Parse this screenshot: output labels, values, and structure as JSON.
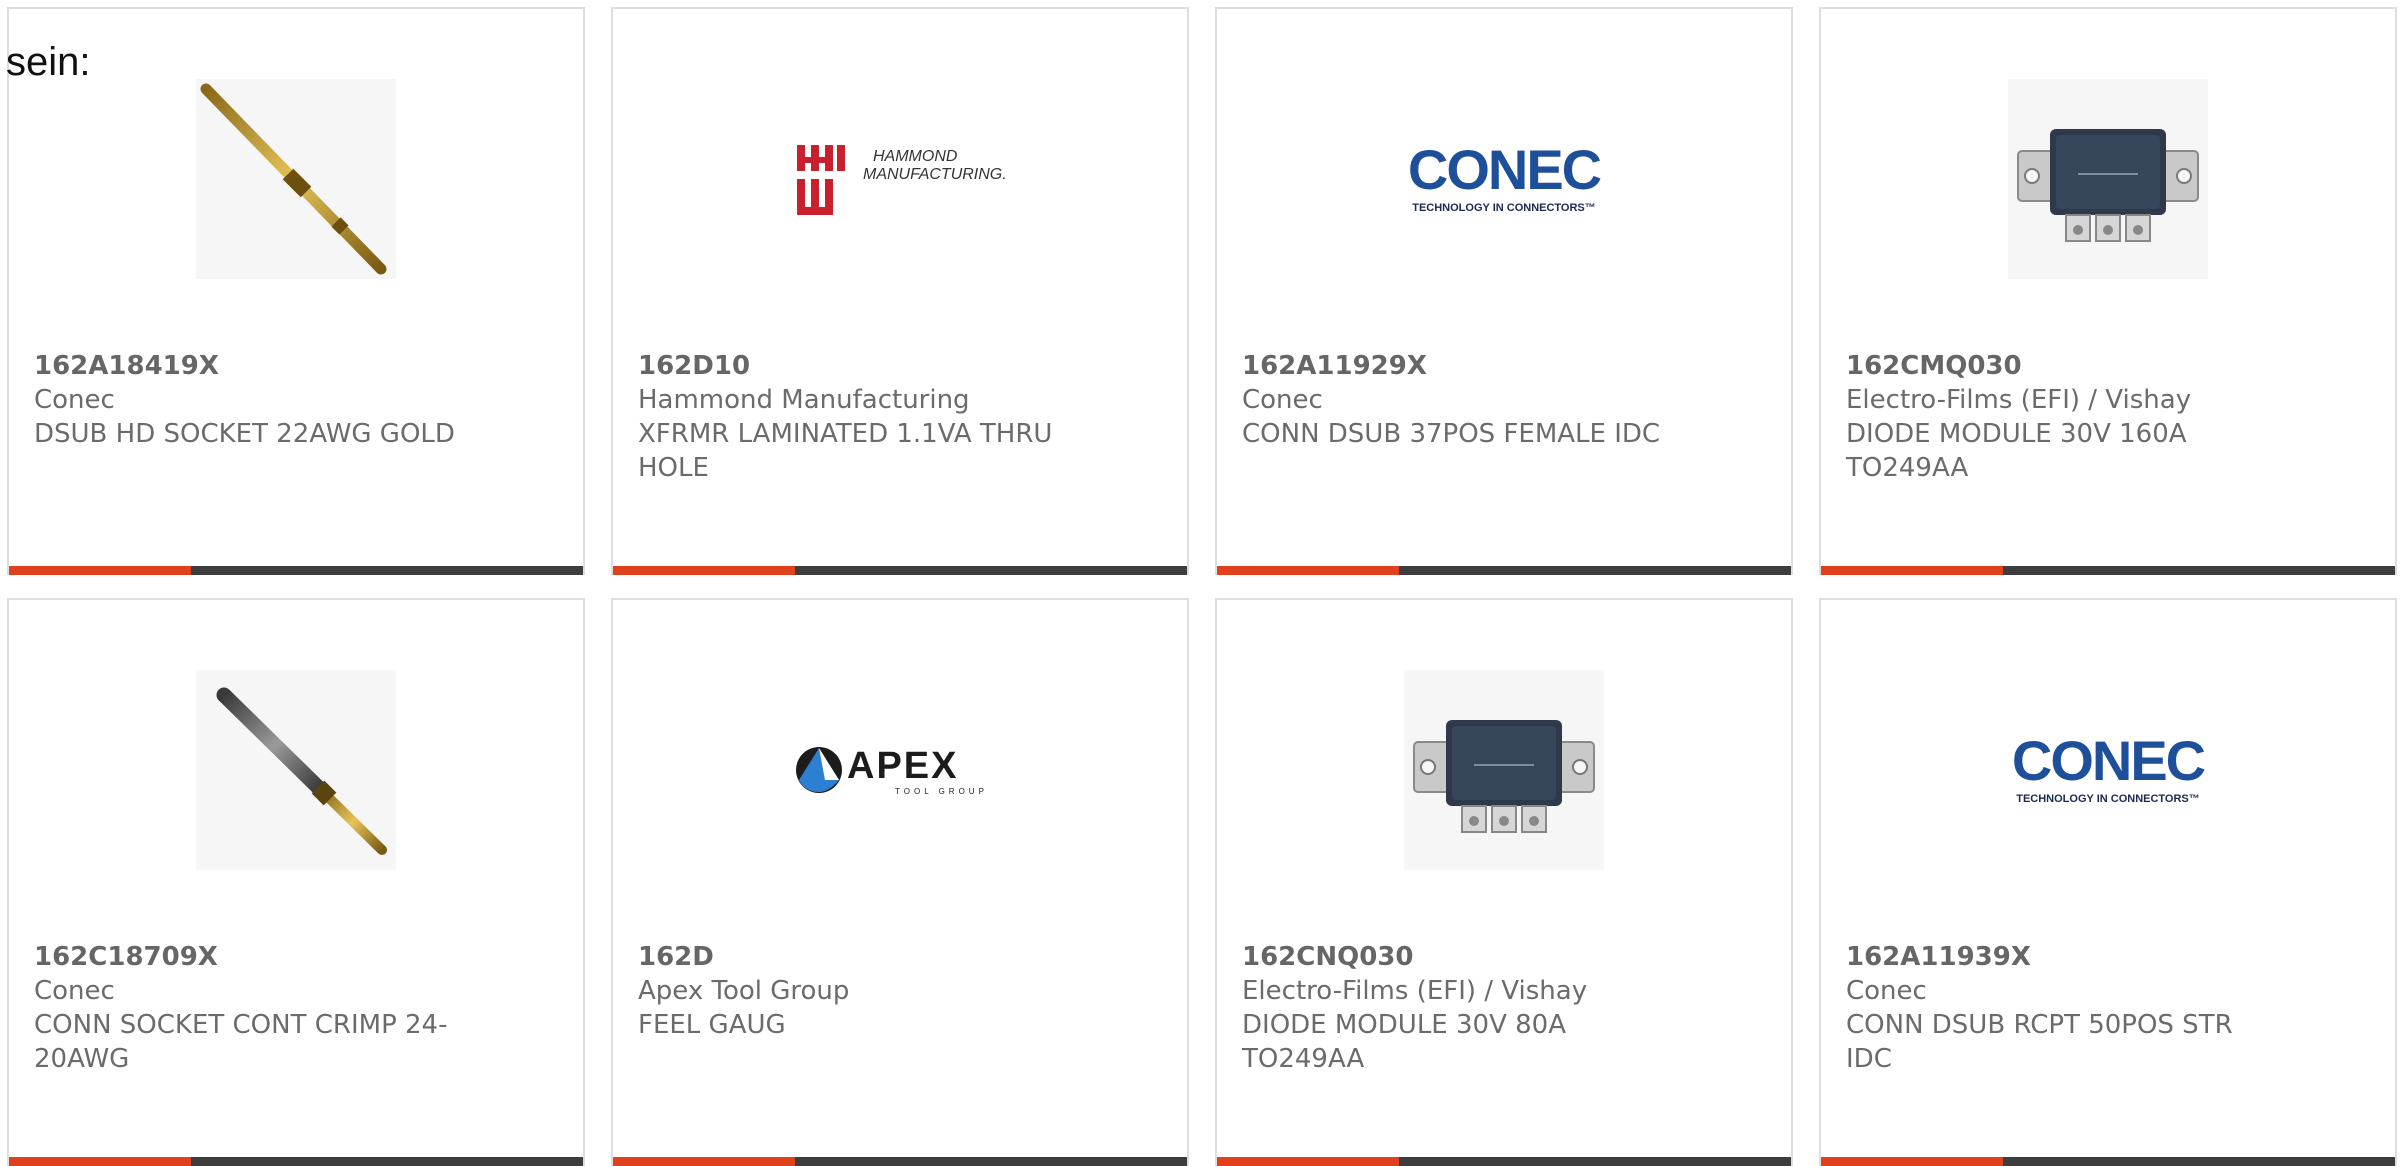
{
  "intro_text": "sein:",
  "colors": {
    "accent": "#e0411d",
    "bar": "#3d3d3d",
    "conec_blue": "#1d4f9a",
    "hammond_red": "#c8202c"
  },
  "products": [
    {
      "part_number": "162A18419X",
      "manufacturer": "Conec",
      "description": "DSUB HD SOCKET 22AWG GOLD",
      "image": "gold-pin-contact-icon"
    },
    {
      "part_number": "162D10",
      "manufacturer": "Hammond Manufacturing",
      "description": "XFRMR LAMINATED 1.1VA THRU HOLE",
      "image": "hammond-logo",
      "logo_line1": "HAMMOND",
      "logo_line2": "MANUFACTURING."
    },
    {
      "part_number": "162A11929X",
      "manufacturer": "Conec",
      "description": "CONN DSUB 37POS FEMALE IDC",
      "image": "conec-logo",
      "logo_main": "CONEC",
      "logo_tag": "TECHNOLOGY IN CONNECTORS™"
    },
    {
      "part_number": "162CMQ030",
      "manufacturer": "Electro-Films (EFI) / Vishay",
      "description": "DIODE MODULE 30V 160A TO249AA",
      "image": "diode-module-icon"
    },
    {
      "part_number": "162C18709X",
      "manufacturer": "Conec",
      "description": "CONN SOCKET CONT CRIMP 24-20AWG",
      "image": "socket-contact-icon"
    },
    {
      "part_number": "162D",
      "manufacturer": "Apex Tool Group",
      "description": "FEEL GAUG",
      "image": "apex-logo",
      "logo_main": "APEX",
      "logo_tag": "TOOL GROUP"
    },
    {
      "part_number": "162CNQ030",
      "manufacturer": "Electro-Films (EFI) / Vishay",
      "description": "DIODE MODULE 30V 80A TO249AA",
      "image": "diode-module-icon"
    },
    {
      "part_number": "162A11939X",
      "manufacturer": "Conec",
      "description": "CONN DSUB RCPT 50POS STR IDC",
      "image": "conec-logo",
      "logo_main": "CONEC",
      "logo_tag": "TECHNOLOGY IN CONNECTORS™"
    }
  ]
}
